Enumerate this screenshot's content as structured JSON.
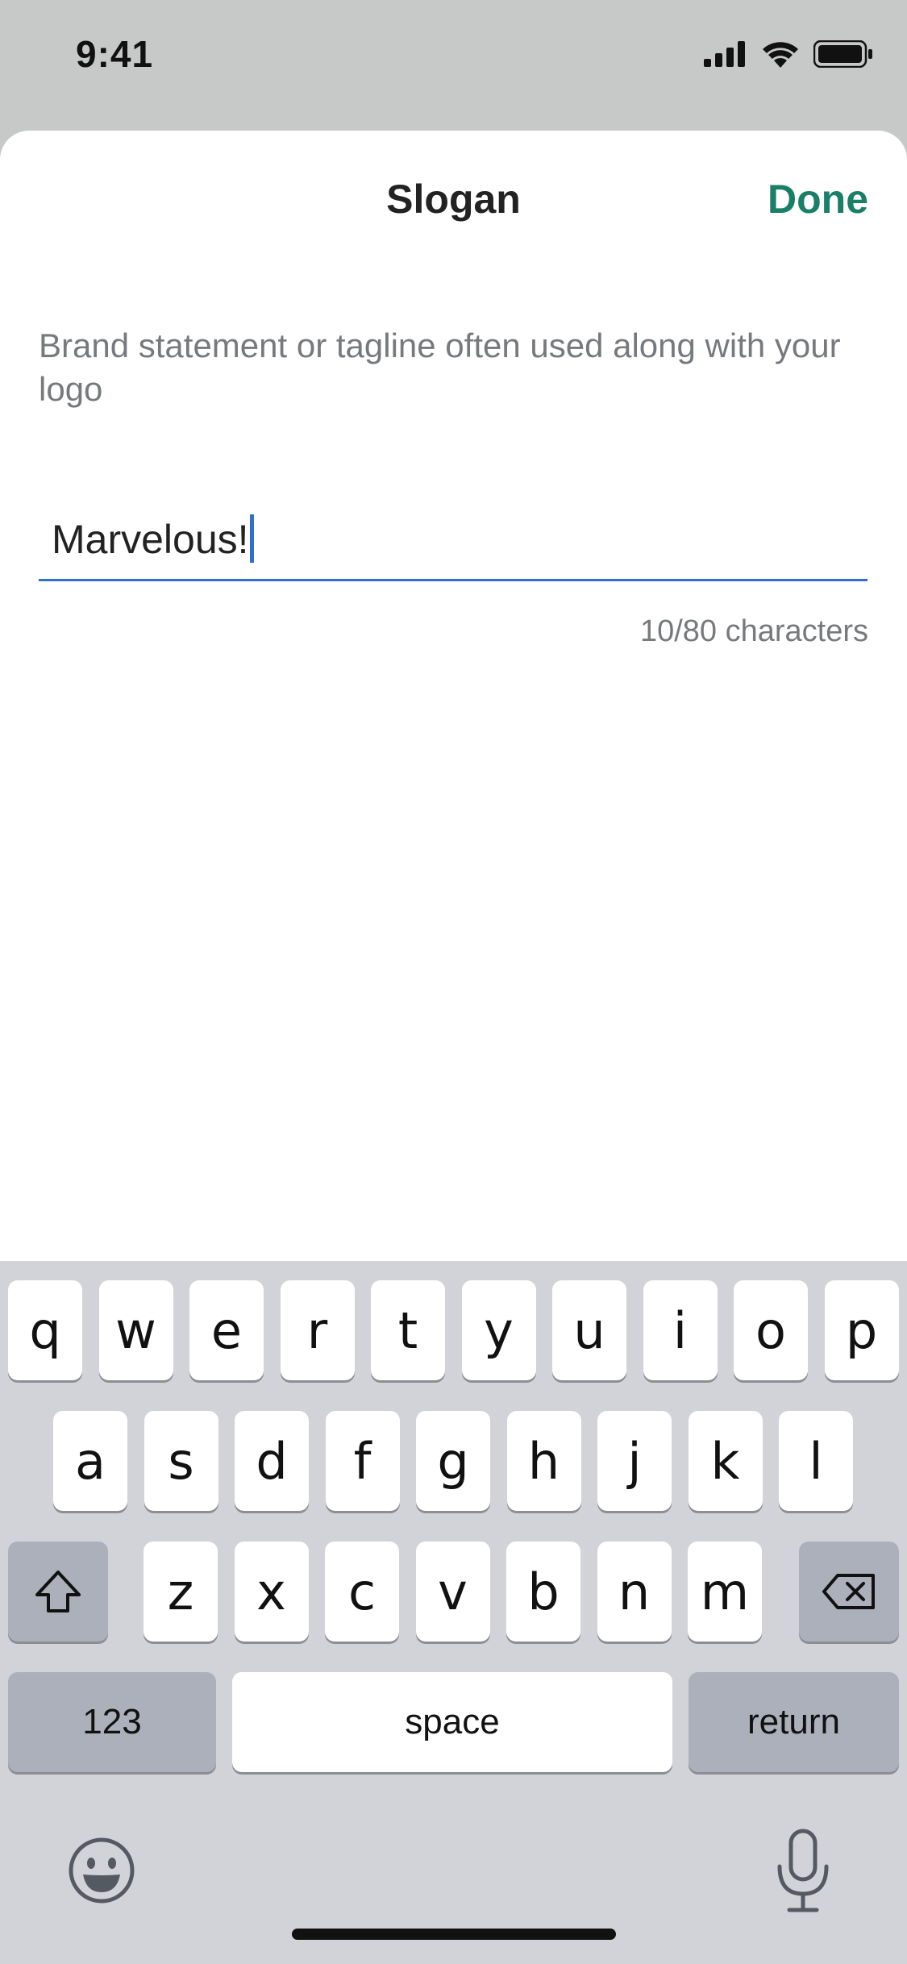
{
  "status_bar": {
    "time": "9:41"
  },
  "sheet": {
    "title": "Slogan",
    "done_label": "Done",
    "description": "Brand statement or tagline often used along with your logo",
    "input_value": "Marvelous!",
    "char_count": "10/80 characters"
  },
  "keyboard": {
    "row1": [
      "q",
      "w",
      "e",
      "r",
      "t",
      "y",
      "u",
      "i",
      "o",
      "p"
    ],
    "row2": [
      "a",
      "s",
      "d",
      "f",
      "g",
      "h",
      "j",
      "k",
      "l"
    ],
    "row3": [
      "z",
      "x",
      "c",
      "v",
      "b",
      "n",
      "m"
    ],
    "numbers_label": "123",
    "space_label": "space",
    "return_label": "return"
  },
  "colors": {
    "accent": "#1a7f67",
    "input_underline": "#2f6fd0",
    "muted_text": "#777a7d",
    "keyboard_bg": "#d1d3d9"
  }
}
